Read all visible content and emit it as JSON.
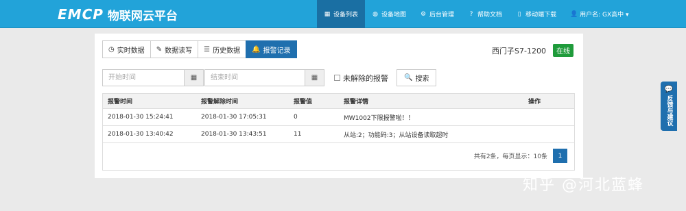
{
  "header": {
    "logo_mark": "EMCP",
    "logo_text": "物联网云平台",
    "nav": [
      {
        "icon": "list-icon",
        "glyph": "▦",
        "label": "设备列表"
      },
      {
        "icon": "globe-icon",
        "glyph": "◍",
        "label": "设备地图"
      },
      {
        "icon": "gears-icon",
        "glyph": "⚙",
        "label": "后台管理"
      },
      {
        "icon": "help-icon",
        "glyph": "?",
        "label": "帮助文档"
      },
      {
        "icon": "mobile-icon",
        "glyph": "▯",
        "label": "移动端下载"
      },
      {
        "icon": "user-icon",
        "glyph": "👤",
        "label": "用户名: GX高中 ▾"
      }
    ]
  },
  "tabs": [
    {
      "icon": "clock-icon",
      "glyph": "◷",
      "label": "实时数据"
    },
    {
      "icon": "pencil-icon",
      "glyph": "✎",
      "label": "数据读写"
    },
    {
      "icon": "table-icon",
      "glyph": "☰",
      "label": "历史数据"
    },
    {
      "icon": "bell-icon",
      "glyph": "🔔",
      "label": "报警记录"
    }
  ],
  "device": {
    "name": "西门子S7-1200",
    "status": "在线"
  },
  "filters": {
    "start_placeholder": "开始时间",
    "end_placeholder": "结束时间",
    "calendar_glyph": "▦",
    "unresolved_label": "未解除的报警",
    "search_label": "搜索",
    "search_glyph": "🔍"
  },
  "table": {
    "headers": [
      "报警时间",
      "报警解除时间",
      "报警值",
      "报警详情",
      "操作"
    ],
    "rows": [
      [
        "2018-01-30 15:24:41",
        "2018-01-30 17:05:31",
        "0",
        "MW1002下限报警啦！！",
        ""
      ],
      [
        "2018-01-30 13:40:42",
        "2018-01-30 13:43:51",
        "11",
        "从站:2；功能码:3；从站设备读取超时",
        ""
      ]
    ]
  },
  "pager": {
    "summary": "共有2条，每页显示：10条",
    "current": "1"
  },
  "feedback": {
    "glyph": "💬",
    "label": "反馈与建议"
  },
  "watermark": "知乎 @河北蓝蜂",
  "colors": {
    "header_bg": "#22a3d9",
    "active_bg": "#1f6fae",
    "online": "#1f9b3b"
  }
}
